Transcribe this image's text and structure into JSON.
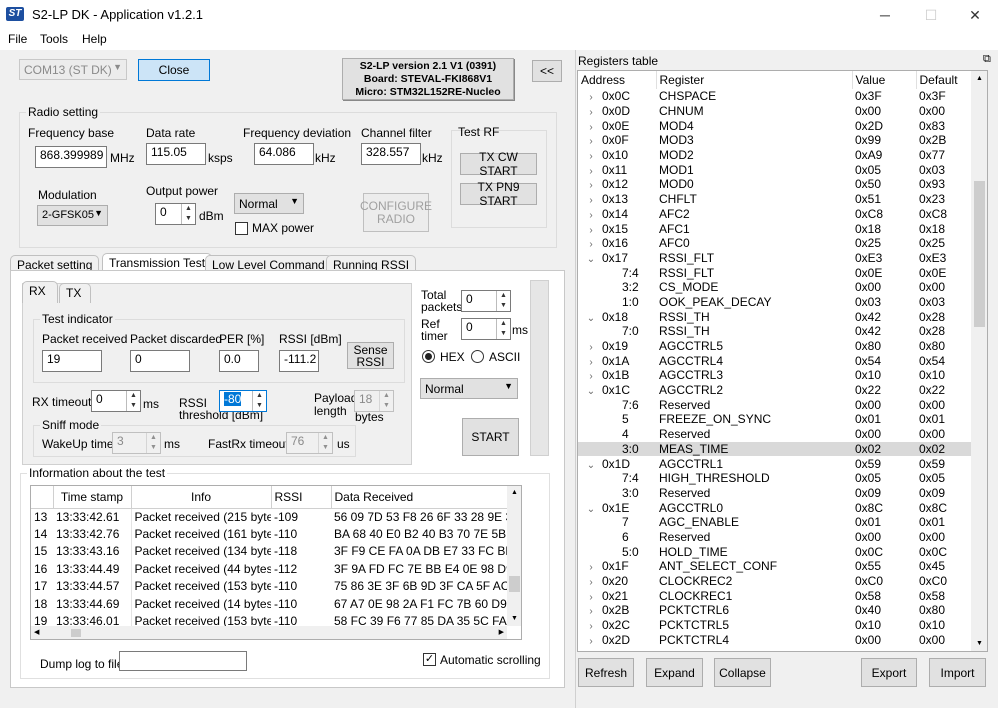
{
  "window": {
    "title": "S2-LP DK - Application v1.2.1",
    "logo": "ST",
    "minimize": "─",
    "maximize": "☐",
    "close": "✕"
  },
  "menu": [
    "File",
    "Tools",
    "Help"
  ],
  "top": {
    "com_port": "COM13 (ST DK)",
    "close_button": "Close",
    "version_line1": "S2-LP version 2.1 V1 (0391)",
    "version_line2": "Board: STEVAL-FKI868V1",
    "version_line3": "Micro: STM32L152RE-Nucleo",
    "collapse_button": "<<"
  },
  "radio": {
    "group": "Radio setting",
    "freq_base_label": "Frequency base",
    "freq_base": "868.399989",
    "freq_unit": "MHz",
    "data_rate_label": "Data rate",
    "data_rate": "115.05",
    "data_rate_unit": "ksps",
    "freq_dev_label": "Frequency deviation",
    "freq_dev": "64.086",
    "freq_dev_unit": "kHz",
    "chan_filter_label": "Channel filter",
    "chan_filter": "328.557",
    "chan_filter_unit": "kHz",
    "test_rf_label": "Test RF",
    "tx_cw": "TX CW START",
    "tx_pn9": "TX PN9 START",
    "modulation_label": "Modulation",
    "modulation": "2-GFSK05",
    "output_power_label": "Output power",
    "output_power": "0",
    "output_power_unit": "dBm",
    "power_mode": "Normal",
    "max_power": "MAX power",
    "configure_line1": "CONFIGURE",
    "configure_line2": "RADIO"
  },
  "tabs": [
    "Packet setting",
    "Transmission Test",
    "Low Level Command",
    "Running RSSI"
  ],
  "inner_tabs": [
    "RX",
    "TX"
  ],
  "test": {
    "indicator_label": "Test indicator",
    "pkt_received_label": "Packet received",
    "pkt_received": "19",
    "pkt_discarded_label": "Packet discarded",
    "pkt_discarded": "0",
    "per_label": "PER [%]",
    "per": "0.0",
    "rssi_label": "RSSI [dBm]",
    "rssi": "-111.2",
    "sense_rssi_line1": "Sense",
    "sense_rssi_line2": "RSSI",
    "rx_timeout_label": "RX timeout",
    "rx_timeout": "0",
    "rx_timeout_unit": "ms",
    "rssi_threshold_label1": "RSSI",
    "rssi_threshold_label2": "threshold [dBm]",
    "rssi_threshold": "-80",
    "payload_label1": "Payload",
    "payload_label2": "length",
    "payload": "18",
    "payload_unit": "bytes",
    "sniff_label": "Sniff mode",
    "wakeup_label": "WakeUp timer",
    "wakeup": "3",
    "wakeup_unit": "ms",
    "fastrx_label": "FastRx timeout",
    "fastrx": "76",
    "fastrx_unit": "us",
    "total_packets_label1": "Total",
    "total_packets_label2": "packets",
    "total_packets": "0",
    "ref_timer_label1": "Ref",
    "ref_timer_label2": "timer",
    "ref_timer": "0",
    "ref_timer_unit": "ms",
    "hex_label": "HEX",
    "ascii_label": "ASCII",
    "mode": "Normal",
    "start": "START"
  },
  "info": {
    "group": "Information about the test",
    "headers": [
      "Time stamp",
      "Info",
      "RSSI",
      "Data Received"
    ],
    "rows": [
      [
        "13",
        "13:33:42.61",
        "Packet received (215 bytes)",
        "-109",
        "56 09 7D 53 F8 26 6F 33 28 9E 36 7F"
      ],
      [
        "14",
        "13:33:42.76",
        "Packet received (161 bytes)",
        "-110",
        "BA 68 40 E0 B2 40 B3 70 7E 5B 97 1"
      ],
      [
        "15",
        "13:33:43.16",
        "Packet received (134 bytes)",
        "-118",
        "3F F9 CE FA 0A DB E7 33 FC BD F4"
      ],
      [
        "16",
        "13:33:44.49",
        "Packet received (44 bytes)",
        "-112",
        "3F 9A FD FC 7E BB E4 0E 98 D9 6D"
      ],
      [
        "17",
        "13:33:44.57",
        "Packet received (153 bytes)",
        "-110",
        "75 86 3E 3F 6B 9D 3F CA 5F AC E4 7"
      ],
      [
        "18",
        "13:33:44.69",
        "Packet received (14 bytes)",
        "-110",
        "67 A7 0E 98 2A F1 FC 7B 60 D9 BC C"
      ],
      [
        "19",
        "13:33:46.01",
        "Packet received (153 bytes)",
        "-110",
        "58 FC 39 F6 77 85 DA 35 5C FA AD 3"
      ]
    ],
    "dump_label": "Dump log to file",
    "dump_file": "",
    "auto_scroll": "Automatic scrolling"
  },
  "registers": {
    "title": "Registers table",
    "pin": "⧉",
    "headers": [
      "Address",
      "Register",
      "Value",
      "Default"
    ],
    "rows": [
      [
        "›",
        "0x0C",
        "CHSPACE",
        "0x3F",
        "0x3F"
      ],
      [
        "›",
        "0x0D",
        "CHNUM",
        "0x00",
        "0x00"
      ],
      [
        "›",
        "0x0E",
        "MOD4",
        "0x2D",
        "0x83"
      ],
      [
        "›",
        "0x0F",
        "MOD3",
        "0x99",
        "0x2B"
      ],
      [
        "›",
        "0x10",
        "MOD2",
        "0xA9",
        "0x77"
      ],
      [
        "›",
        "0x11",
        "MOD1",
        "0x05",
        "0x03"
      ],
      [
        "›",
        "0x12",
        "MOD0",
        "0x50",
        "0x93"
      ],
      [
        "›",
        "0x13",
        "CHFLT",
        "0x51",
        "0x23"
      ],
      [
        "›",
        "0x14",
        "AFC2",
        "0xC8",
        "0xC8"
      ],
      [
        "›",
        "0x15",
        "AFC1",
        "0x18",
        "0x18"
      ],
      [
        "›",
        "0x16",
        "AFC0",
        "0x25",
        "0x25"
      ],
      [
        "⌄",
        "0x17",
        "RSSI_FLT",
        "0xE3",
        "0xE3"
      ],
      [
        "",
        "7:4",
        "RSSI_FLT",
        "0x0E",
        "0x0E"
      ],
      [
        "",
        "3:2",
        "CS_MODE",
        "0x00",
        "0x00"
      ],
      [
        "",
        "1:0",
        "OOK_PEAK_DECAY",
        "0x03",
        "0x03"
      ],
      [
        "⌄",
        "0x18",
        "RSSI_TH",
        "0x42",
        "0x28"
      ],
      [
        "",
        "7:0",
        "RSSI_TH",
        "0x42",
        "0x28"
      ],
      [
        "›",
        "0x19",
        "AGCCTRL5",
        "0x80",
        "0x80"
      ],
      [
        "›",
        "0x1A",
        "AGCCTRL4",
        "0x54",
        "0x54"
      ],
      [
        "›",
        "0x1B",
        "AGCCTRL3",
        "0x10",
        "0x10"
      ],
      [
        "⌄",
        "0x1C",
        "AGCCTRL2",
        "0x22",
        "0x22"
      ],
      [
        "",
        "7:6",
        "Reserved",
        "0x00",
        "0x00"
      ],
      [
        "",
        "5",
        "FREEZE_ON_SYNC",
        "0x01",
        "0x01"
      ],
      [
        "",
        "4",
        "Reserved",
        "0x00",
        "0x00"
      ],
      [
        "",
        "3:0",
        "MEAS_TIME",
        "0x02",
        "0x02"
      ],
      [
        "⌄",
        "0x1D",
        "AGCCTRL1",
        "0x59",
        "0x59"
      ],
      [
        "",
        "7:4",
        "HIGH_THRESHOLD",
        "0x05",
        "0x05"
      ],
      [
        "",
        "3:0",
        "Reserved",
        "0x09",
        "0x09"
      ],
      [
        "⌄",
        "0x1E",
        "AGCCTRL0",
        "0x8C",
        "0x8C"
      ],
      [
        "",
        "7",
        "AGC_ENABLE",
        "0x01",
        "0x01"
      ],
      [
        "",
        "6",
        "Reserved",
        "0x00",
        "0x00"
      ],
      [
        "",
        "5:0",
        "HOLD_TIME",
        "0x0C",
        "0x0C"
      ],
      [
        "›",
        "0x1F",
        "ANT_SELECT_CONF",
        "0x55",
        "0x45"
      ],
      [
        "›",
        "0x20",
        "CLOCKREC2",
        "0xC0",
        "0xC0"
      ],
      [
        "›",
        "0x21",
        "CLOCKREC1",
        "0x58",
        "0x58"
      ],
      [
        "›",
        "0x2B",
        "PCKTCTRL6",
        "0x40",
        "0x80"
      ],
      [
        "›",
        "0x2C",
        "PCKTCTRL5",
        "0x10",
        "0x10"
      ],
      [
        "›",
        "0x2D",
        "PCKTCTRL4",
        "0x00",
        "0x00"
      ]
    ],
    "selected_row": 24,
    "refresh": "Refresh",
    "expand": "Expand",
    "collapse": "Collapse",
    "export": "Export",
    "import": "Import"
  }
}
